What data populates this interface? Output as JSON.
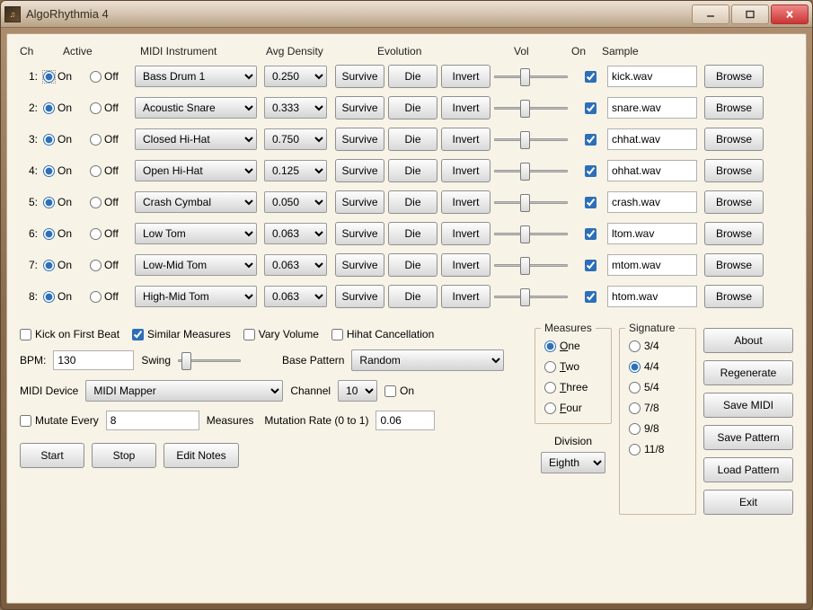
{
  "app": {
    "title": "AlgoRhythmia 4"
  },
  "headers": {
    "ch": "Ch",
    "active": "Active",
    "midi": "MIDI Instrument",
    "density": "Avg Density",
    "evolution": "Evolution",
    "vol": "Vol",
    "on": "On",
    "sample": "Sample"
  },
  "labels": {
    "on": "On",
    "off": "Off",
    "browse": "Browse",
    "survive": "Survive",
    "die": "Die",
    "invert": "Invert",
    "kick_first": "Kick on First Beat",
    "similar": "Similar Measures",
    "vary_vol": "Vary Volume",
    "hihat_cancel": "Hihat Cancellation",
    "bpm": "BPM:",
    "swing": "Swing",
    "base_pattern": "Base Pattern",
    "midi_device": "MIDI Device",
    "channel": "Channel",
    "mutate_every": "Mutate Every",
    "measures_word": "Measures",
    "mutation_rate": "Mutation Rate (0 to 1)",
    "start": "Start",
    "stop": "Stop",
    "edit_notes": "Edit Notes",
    "measures_group": "Measures",
    "signature_group": "Signature",
    "division": "Division",
    "about": "About",
    "regenerate": "Regenerate",
    "save_midi": "Save MIDI",
    "save_pattern": "Save Pattern",
    "load_pattern": "Load Pattern",
    "exit": "Exit"
  },
  "values": {
    "bpm": "130",
    "base_pattern": "Random",
    "midi_device": "MIDI Mapper",
    "channel": "10",
    "channel_on": false,
    "mutate_every_chk": false,
    "mutate_every_val": "8",
    "mutation_rate": "0.06",
    "kick_first": false,
    "similar": true,
    "vary_vol": false,
    "hihat_cancel": false,
    "division": "Eighth"
  },
  "measures_opts": [
    "One",
    "Two",
    "Three",
    "Four"
  ],
  "measures_selected": "One",
  "sig_opts": [
    "3/4",
    "4/4",
    "5/4",
    "7/8",
    "9/8",
    "11/8"
  ],
  "sig_selected": "4/4",
  "channels": [
    {
      "n": "1:",
      "active": "on",
      "instrument": "Bass Drum 1",
      "density": "0.250",
      "on": true,
      "sample": "kick.wav"
    },
    {
      "n": "2:",
      "active": "on",
      "instrument": "Acoustic Snare",
      "density": "0.333",
      "on": true,
      "sample": "snare.wav"
    },
    {
      "n": "3:",
      "active": "on",
      "instrument": "Closed Hi-Hat",
      "density": "0.750",
      "on": true,
      "sample": "chhat.wav"
    },
    {
      "n": "4:",
      "active": "on",
      "instrument": "Open Hi-Hat",
      "density": "0.125",
      "on": true,
      "sample": "ohhat.wav"
    },
    {
      "n": "5:",
      "active": "on",
      "instrument": "Crash Cymbal",
      "density": "0.050",
      "on": true,
      "sample": "crash.wav"
    },
    {
      "n": "6:",
      "active": "on",
      "instrument": "Low Tom",
      "density": "0.063",
      "on": true,
      "sample": "ltom.wav"
    },
    {
      "n": "7:",
      "active": "on",
      "instrument": "Low-Mid Tom",
      "density": "0.063",
      "on": true,
      "sample": "mtom.wav"
    },
    {
      "n": "8:",
      "active": "on",
      "instrument": "High-Mid Tom",
      "density": "0.063",
      "on": true,
      "sample": "htom.wav"
    }
  ]
}
